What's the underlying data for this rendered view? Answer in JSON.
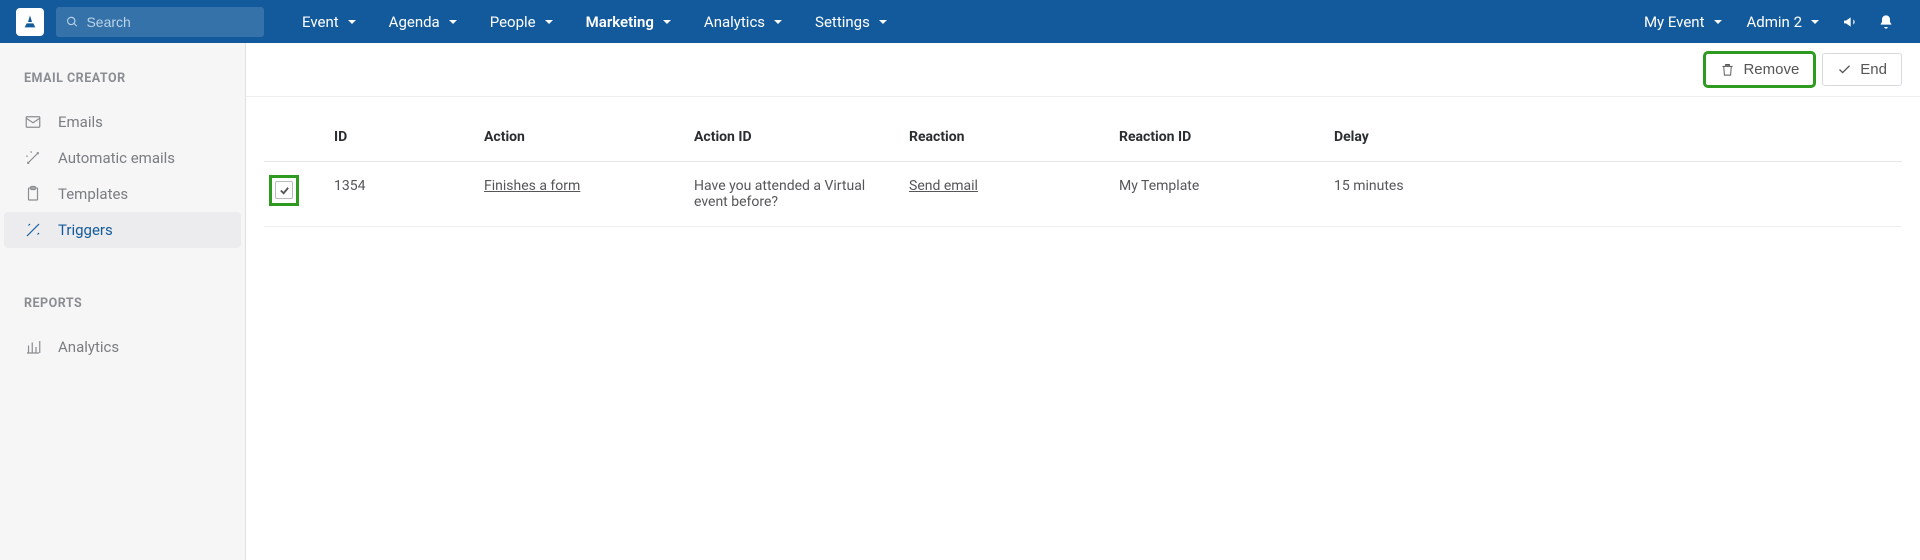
{
  "topbar": {
    "search_placeholder": "Search",
    "nav": [
      {
        "label": "Event"
      },
      {
        "label": "Agenda"
      },
      {
        "label": "People"
      },
      {
        "label": "Marketing",
        "active": true
      },
      {
        "label": "Analytics"
      },
      {
        "label": "Settings"
      }
    ],
    "event_selector": "My Event",
    "user": "Admin 2"
  },
  "sidebar": {
    "section1_title": "EMAIL CREATOR",
    "items1": [
      {
        "label": "Emails"
      },
      {
        "label": "Automatic emails"
      },
      {
        "label": "Templates"
      },
      {
        "label": "Triggers",
        "active": true
      }
    ],
    "section2_title": "REPORTS",
    "items2": [
      {
        "label": "Analytics"
      }
    ]
  },
  "actions": {
    "remove": "Remove",
    "end": "End"
  },
  "table": {
    "headers": {
      "id": "ID",
      "action": "Action",
      "action_id": "Action ID",
      "reaction": "Reaction",
      "reaction_id": "Reaction ID",
      "delay": "Delay"
    },
    "rows": [
      {
        "id": "1354",
        "action": "Finishes a form",
        "action_id": "Have you attended a Virtual event before?",
        "reaction": "Send email",
        "reaction_id": "My Template",
        "delay": "15 minutes",
        "checked": true
      }
    ]
  }
}
